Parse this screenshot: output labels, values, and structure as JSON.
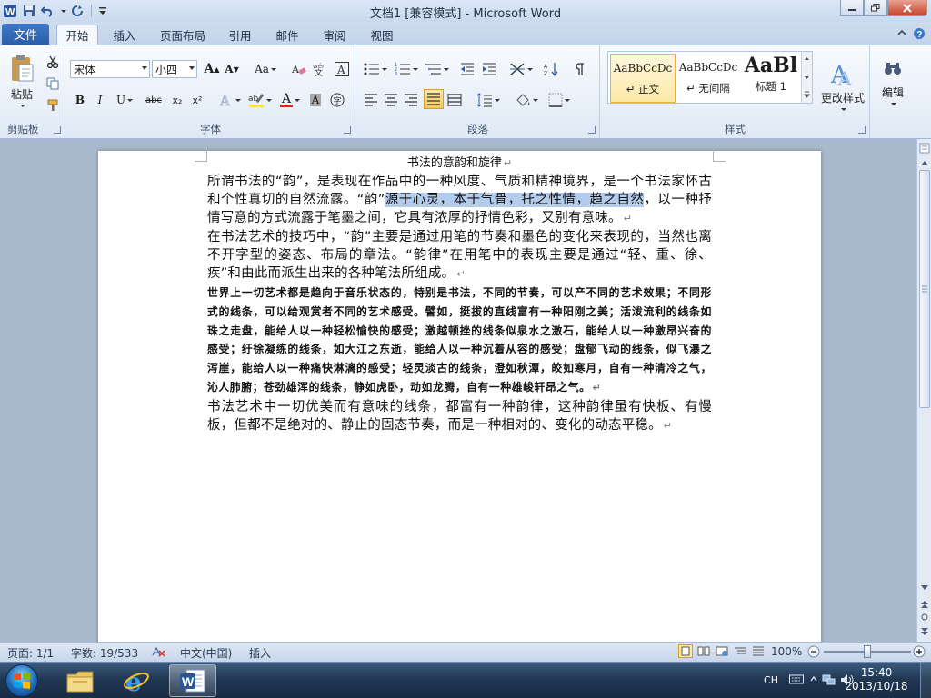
{
  "window": {
    "title": "文档1 [兼容模式] - Microsoft Word"
  },
  "qat": {
    "icons": [
      "word-logo-icon",
      "save-icon",
      "undo-icon",
      "redo-icon",
      "customize-icon"
    ]
  },
  "tabs": {
    "file": "文件",
    "items": [
      "开始",
      "插入",
      "页面布局",
      "引用",
      "邮件",
      "审阅",
      "视图"
    ],
    "active": "开始"
  },
  "ribbon": {
    "clipboard": {
      "label": "剪贴板",
      "paste": "粘贴"
    },
    "font": {
      "label": "字体",
      "font_name": "宋体",
      "font_size": "小四",
      "grow": "A",
      "shrink": "A",
      "change_case": "Aa",
      "bold": "B",
      "italic": "I",
      "underline": "U",
      "strike": "abc",
      "subscript": "x₂",
      "superscript": "x²",
      "font_color_letter": "A",
      "char_shade_letter": "A"
    },
    "paragraph": {
      "label": "段落"
    },
    "styles": {
      "label": "样式",
      "items": [
        {
          "sample": "AaBbCcDc",
          "name": "正文",
          "selected": true
        },
        {
          "sample": "AaBbCcDc",
          "name": "无间隔",
          "selected": false
        },
        {
          "sample": "AaBl",
          "name": "标题 1",
          "selected": false
        }
      ],
      "change_styles": "更改样式"
    },
    "editing": {
      "label": "编辑"
    }
  },
  "document": {
    "title": "书法的意韵和旋律",
    "paragraphs": {
      "p1_a": "所谓书法的“韵”，是表现在作品中的一种风度、气质和精神境界，是一个书法家怀古和个性真切的自然流露。“韵”",
      "p1_hl": "源于心灵，本于气骨，托之性情，趋之自然",
      "p1_b": "，以一种抒情写意的方式流露于笔墨之间，它具有浓厚的抒情色彩，又别有意味。",
      "p2": "在书法艺术的技巧中，“韵”主要是通过用笔的节奏和墨色的变化来表现的，当然也离不开字型的姿态、布局的章法。“韵律”在用笔中的表现主要是通过“轻、重、徐、疾”和由此而派生出来的各种笔法所组成。",
      "p3": "世界上一切艺术都是趋向于音乐状态的，特别是书法，不同的节奏，可以产不同的艺术效果；不同形式的线条，可以给观赏者不同的艺术感受。譬如，挺拔的直线富有一种阳刚之美；活泼流利的线条如珠之走盘，能给人以一种轻松愉快的感受；激越顿挫的线条似泉水之激石，能给人以一种激昂兴奋的感受；纡徐凝练的线条，如大江之东逝，能给人以一种沉着从容的感受；盘郁飞动的线条，似飞瀑之泻崖，能给人以一种痛快淋漓的感受；轻灵淡古的线条，澄如秋潭，皎如寒月，自有一种清冷之气，沁人肺腑；苍劲雄浑的线条，静如虎卧，动如龙腾，自有一种雄峻轩昂之气。",
      "p4": "书法艺术中一切优美而有意味的线条，都富有一种韵律，这种韵律虽有快板、有慢板，但都不是绝对的、静止的固态节奏，而是一种相对的、变化的动态平稳。",
      "mark": "↵"
    },
    "colors": {
      "highlight": "#b4ccec"
    }
  },
  "statusbar": {
    "page": "页面: 1/1",
    "words": "字数: 19/533",
    "language": "中文(中国)",
    "mode": "插入",
    "zoom": "100%",
    "zoom_level": 0.5
  },
  "taskbar": {
    "apps": [
      "explorer-icon",
      "ie-icon",
      "word-icon"
    ],
    "lang": "CH",
    "time": "15:40",
    "date": "2013/10/18"
  }
}
